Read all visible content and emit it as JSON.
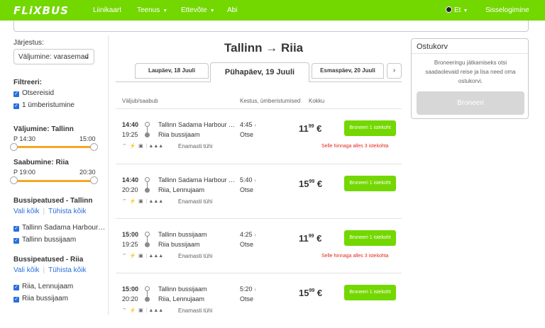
{
  "header": {
    "logo": "FLiXBUS",
    "nav": [
      {
        "label": "Liinikaart",
        "dropdown": false
      },
      {
        "label": "Teenus",
        "dropdown": true
      },
      {
        "label": "Ettevõte",
        "dropdown": true
      },
      {
        "label": "Abi",
        "dropdown": false
      }
    ],
    "language": "Et",
    "login": "Sisselogimine"
  },
  "sidebar": {
    "sort_heading": "Järjestus:",
    "sort_value": "Väljumine: varasemad",
    "filter_heading": "Filtreeri:",
    "filters": [
      {
        "label": "Otsereisid",
        "checked": true
      },
      {
        "label": "1 ümberistumine",
        "checked": true
      }
    ],
    "departure_heading": "Väljumine: Tallinn",
    "departure_from": "P 14:30",
    "departure_to": "15:00",
    "arrival_heading": "Saabumine: Riia",
    "arrival_from": "P 19:00",
    "arrival_to": "20:30",
    "stops_tallinn_heading": "Bussipeatused - Tallinn",
    "select_all": "Vali kõik",
    "clear_all": "Tühista kõik",
    "stops_tallinn": [
      {
        "label": "Tallinn Sadama Harbour…",
        "checked": true
      },
      {
        "label": "Tallinn bussijaam",
        "checked": true
      }
    ],
    "stops_riia_heading": "Bussipeatused - Riia",
    "stops_riia": [
      {
        "label": "Riia, Lennujaam",
        "checked": true
      },
      {
        "label": "Riia bussijaam",
        "checked": true
      }
    ]
  },
  "route": {
    "title": "Tallinn → Riia",
    "days": [
      {
        "label": "Laupäev, 18 Juuli",
        "active": false
      },
      {
        "label": "Pühapäev, 19 Juuli",
        "active": true
      },
      {
        "label": "Esmaspäev, 20 Juuli",
        "active": false
      }
    ],
    "next_icon": "chevron-right-icon"
  },
  "columns": {
    "departure_arrival": "Väljub/saabub",
    "duration": "Kestus, ümberistumised",
    "total": "Kokku"
  },
  "results": [
    {
      "dep_time": "14:40",
      "arr_time": "19:25",
      "from": "Tallinn Sadama Harbour …",
      "to": "Riia bussijaam",
      "duration": "4:45",
      "transfers": "Otse",
      "price_main": "11",
      "price_cents": "99",
      "currency": "€",
      "book_label": "Broneeri 1 istekoht",
      "capacity": "Enamasti tühi",
      "warning": "Selle hinnaga alles 3 istekohta"
    },
    {
      "dep_time": "14:40",
      "arr_time": "20:20",
      "from": "Tallinn Sadama Harbour …",
      "to": "Riia, Lennujaam",
      "duration": "5:40",
      "transfers": "Otse",
      "price_main": "15",
      "price_cents": "99",
      "currency": "€",
      "book_label": "Broneeri 1 istekoht",
      "capacity": "Enamasti tühi",
      "warning": ""
    },
    {
      "dep_time": "15:00",
      "arr_time": "19:25",
      "from": "Tallinn bussijaam",
      "to": "Riia bussijaam",
      "duration": "4:25",
      "transfers": "Otse",
      "price_main": "11",
      "price_cents": "99",
      "currency": "€",
      "book_label": "Broneeri 1 istekoht",
      "capacity": "Enamasti tühi",
      "warning": "Selle hinnaga alles 3 istekohta"
    },
    {
      "dep_time": "15:00",
      "arr_time": "20:20",
      "from": "Tallinn bussijaam",
      "to": "Riia, Lennujaam",
      "duration": "5:20",
      "transfers": "Otse",
      "price_main": "15",
      "price_cents": "99",
      "currency": "€",
      "book_label": "Broneeri 1 istekoht",
      "capacity": "Enamasti tühi",
      "warning": ""
    }
  ],
  "cart": {
    "title": "Ostukorv",
    "text": "Broneeringu jätkamiseks otsi saadaolevaid reise ja lisa need oma ostukorvi.",
    "button": "Broneeri"
  },
  "colors": {
    "brand_green": "#73d700",
    "slider_orange": "#f5a623",
    "warning_red": "#e0281b",
    "link_blue": "#2a6fdb"
  }
}
